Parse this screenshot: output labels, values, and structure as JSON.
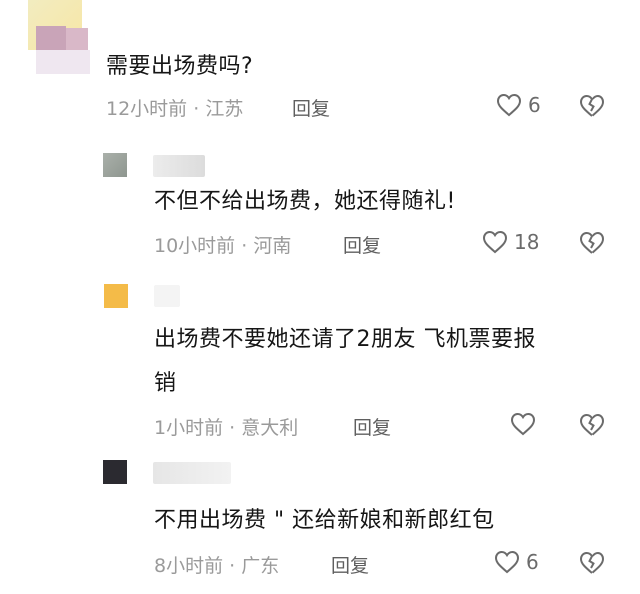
{
  "comments": [
    {
      "text": "需要出场费吗?",
      "time": "12小时前",
      "location": "江苏",
      "reply": "回复",
      "likes": "6"
    },
    {
      "text": "不但不给出场费，她还得随礼!",
      "time": "10小时前",
      "location": "河南",
      "reply": "回复",
      "likes": "18"
    },
    {
      "text_line1": "出场费不要她还请了2朋友 飞机票要报",
      "text_line2": "销",
      "time": "1小时前",
      "location": "意大利",
      "reply": "回复",
      "likes": ""
    },
    {
      "text": "不用出场费 \" 还给新娘和新郎红包",
      "time": "8小时前",
      "location": "广东",
      "reply": "回复",
      "likes": "6"
    }
  ],
  "meta_separator": "·",
  "colors": {
    "avatar_yellow": "#f4bb48",
    "avatar_dark": "#2b2a30",
    "avatar_gray": "#9aa19a",
    "avatar_pink": "#c7a3b7"
  }
}
